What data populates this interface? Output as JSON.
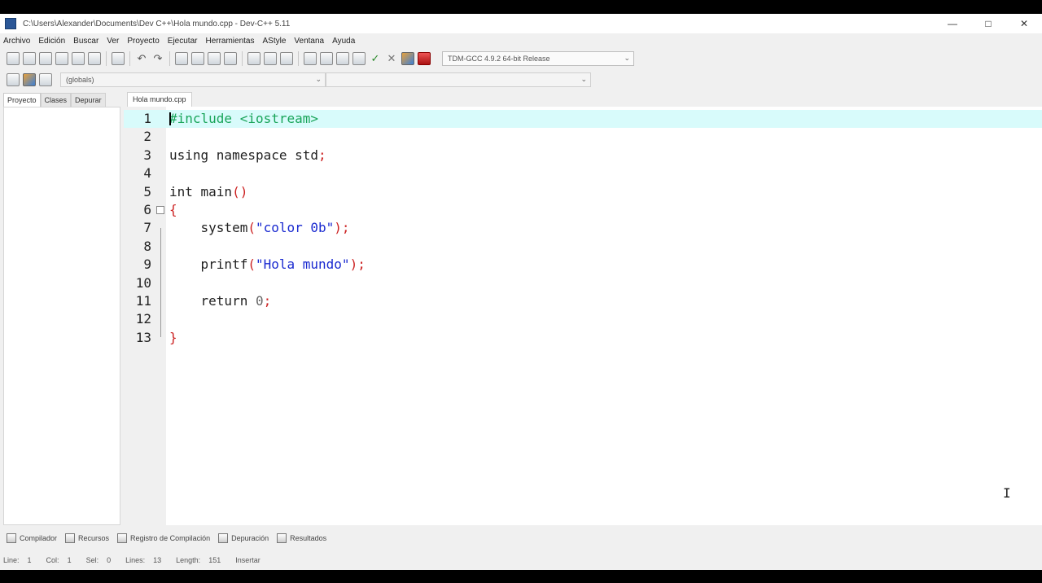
{
  "window": {
    "title": "C:\\Users\\Alexander\\Documents\\Dev C++\\Hola mundo.cpp - Dev-C++ 5.11",
    "minimize_icon": "minimize-icon",
    "maximize_icon": "maximize-icon",
    "close_icon": "close-icon",
    "minimize": "—",
    "maximize": "□",
    "close": "✕"
  },
  "menu": [
    "Archivo",
    "Edición",
    "Buscar",
    "Ver",
    "Proyecto",
    "Ejecutar",
    "Herramientas",
    "AStyle",
    "Ventana",
    "Ayuda"
  ],
  "toolbar": {
    "compiler": "TDM-GCC 4.9.2 64-bit Release",
    "class_select": "(globals)",
    "arrow": "⌄",
    "check": "✓",
    "cross": "✕",
    "undo": "↶",
    "redo": "↷"
  },
  "left_tabs": [
    "Proyecto",
    "Clases",
    "Depurar"
  ],
  "file_tab": "Hola mundo.cpp",
  "code": [
    {
      "num": "1",
      "parts": [
        [
          "#include <iostream>",
          "pre"
        ]
      ]
    },
    {
      "num": "2",
      "parts": []
    },
    {
      "num": "3",
      "parts": [
        [
          "using namespace std",
          "kw"
        ],
        [
          ";",
          "sym"
        ]
      ]
    },
    {
      "num": "4",
      "parts": []
    },
    {
      "num": "5",
      "parts": [
        [
          "int main",
          "kw"
        ],
        [
          "()",
          "sym"
        ]
      ]
    },
    {
      "num": "6",
      "parts": [
        [
          "{",
          "sym"
        ]
      ]
    },
    {
      "num": "7",
      "parts": [
        [
          "    system",
          "kw"
        ],
        [
          "(",
          "sym"
        ],
        [
          "\"color 0b\"",
          "str"
        ],
        [
          ");",
          "sym"
        ]
      ]
    },
    {
      "num": "8",
      "parts": []
    },
    {
      "num": "9",
      "parts": [
        [
          "    printf",
          "kw"
        ],
        [
          "(",
          "sym"
        ],
        [
          "\"Hola mundo\"",
          "str"
        ],
        [
          ");",
          "sym"
        ]
      ]
    },
    {
      "num": "10",
      "parts": []
    },
    {
      "num": "11",
      "parts": [
        [
          "    return ",
          "kw"
        ],
        [
          "0",
          "num"
        ],
        [
          ";",
          "sym"
        ]
      ]
    },
    {
      "num": "12",
      "parts": []
    },
    {
      "num": "13",
      "parts": [
        [
          "}",
          "sym"
        ]
      ]
    }
  ],
  "bottom_tabs": [
    {
      "label": "Compilador",
      "icon": "compiler-icon"
    },
    {
      "label": "Recursos",
      "icon": "resources-icon"
    },
    {
      "label": "Registro de Compilación",
      "icon": "compile-log-icon"
    },
    {
      "label": "Depuración",
      "icon": "debug-icon"
    },
    {
      "label": "Resultados",
      "icon": "results-icon"
    }
  ],
  "status": {
    "line_label": "Line:",
    "line_value": "1",
    "col_label": "Col:",
    "col_value": "1",
    "sel_label": "Sel:",
    "sel_value": "0",
    "lines_label": "Lines:",
    "lines_value": "13",
    "length_label": "Length:",
    "length_value": "151",
    "mode": "Insertar"
  }
}
